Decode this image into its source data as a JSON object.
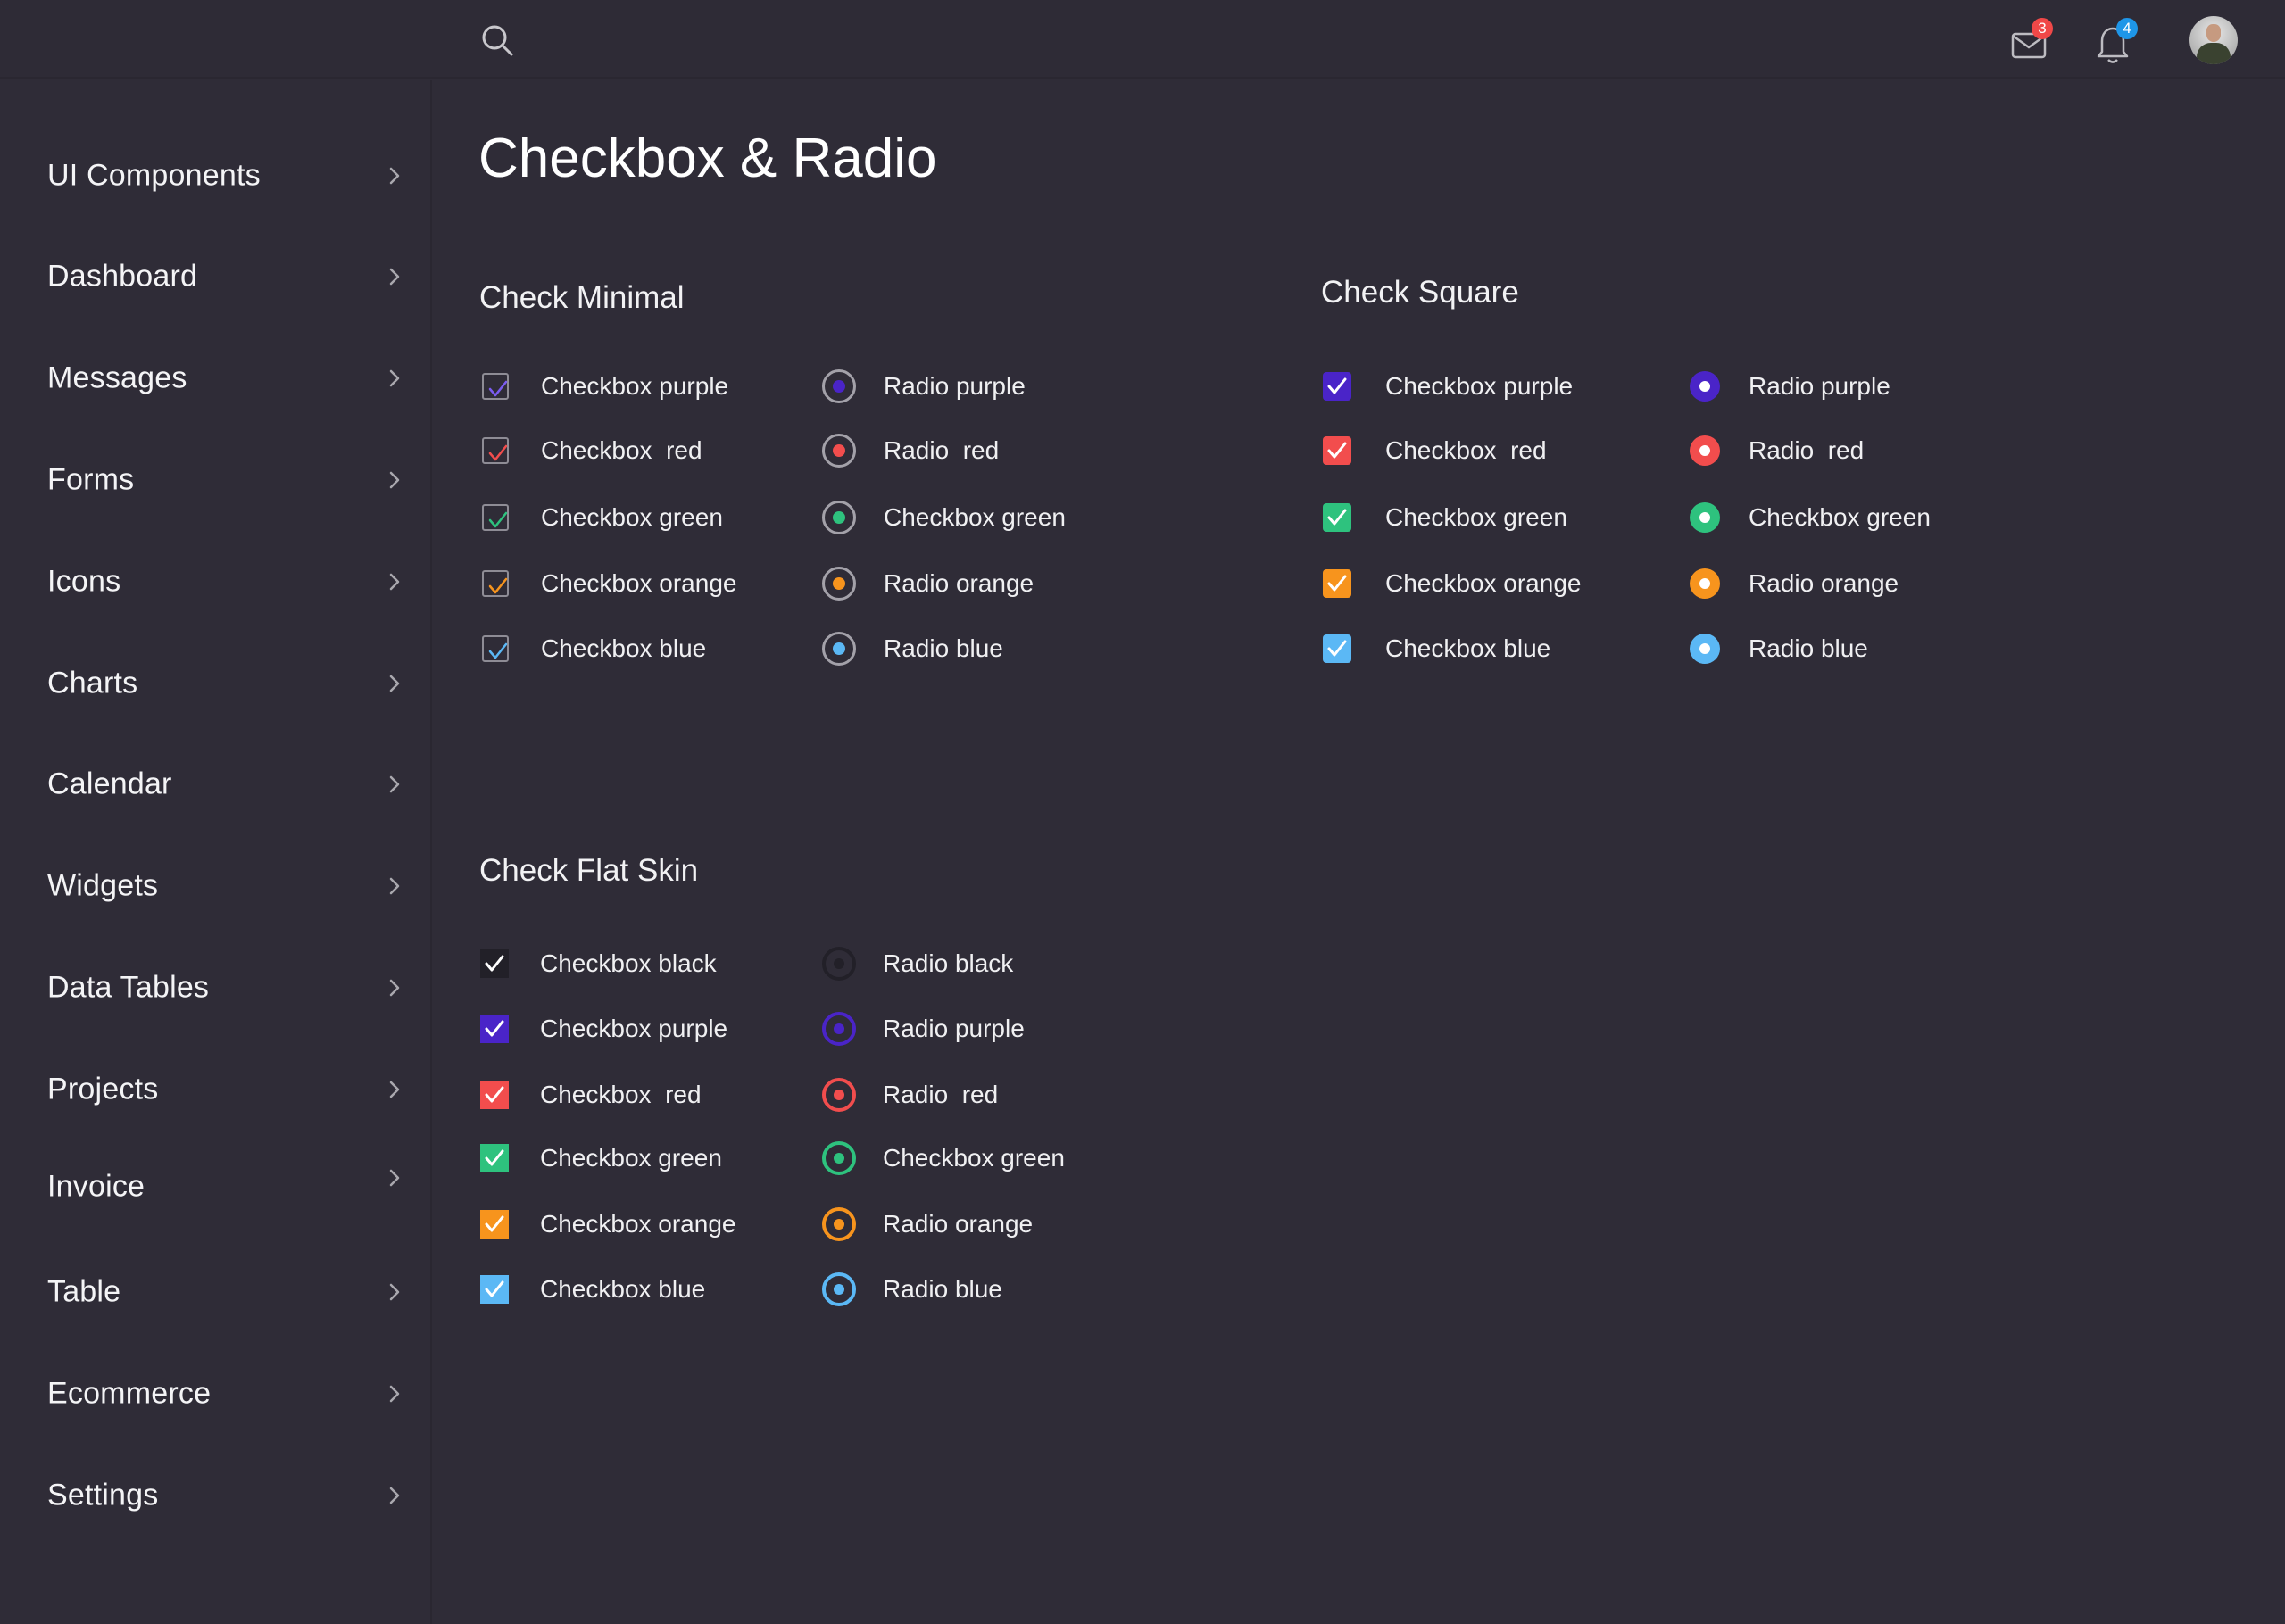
{
  "topbar": {
    "search_icon": "search-icon",
    "mail": {
      "icon": "mail-icon",
      "badge": "3",
      "badge_color": "#f04848"
    },
    "notifications": {
      "icon": "bell-icon",
      "badge": "4",
      "badge_color": "#1e96e8"
    },
    "avatar": "user-avatar"
  },
  "sidebar": {
    "items": [
      {
        "label": "UI Components"
      },
      {
        "label": "Dashboard"
      },
      {
        "label": "Messages"
      },
      {
        "label": "Forms"
      },
      {
        "label": "Icons"
      },
      {
        "label": "Charts"
      },
      {
        "label": "Calendar"
      },
      {
        "label": "Widgets"
      },
      {
        "label": "Data Tables"
      },
      {
        "label": "Projects"
      },
      {
        "label": "Invoice"
      },
      {
        "label": "Table"
      },
      {
        "label": "Ecommerce"
      },
      {
        "label": "Settings"
      }
    ]
  },
  "page": {
    "title": "Checkbox & Radio"
  },
  "colors": {
    "purple": "#4a24c8",
    "purple_minimal": "#7b5cf0",
    "red": "#f24d4d",
    "green": "#2ec27e",
    "orange": "#f7941d",
    "blue": "#5bb8f5",
    "black": "#222028"
  },
  "sections": {
    "minimal": {
      "title": "Check Minimal",
      "checkboxes": [
        {
          "label": "Checkbox purple",
          "color": "purple_minimal",
          "checked": true
        },
        {
          "label": "Checkbox  red",
          "color": "red",
          "checked": true
        },
        {
          "label": "Checkbox green",
          "color": "green",
          "checked": true
        },
        {
          "label": "Checkbox orange",
          "color": "orange",
          "checked": true
        },
        {
          "label": "Checkbox blue",
          "color": "blue",
          "checked": true
        }
      ],
      "radios": [
        {
          "label": "Radio purple",
          "color": "purple",
          "checked": true
        },
        {
          "label": "Radio  red",
          "color": "red",
          "checked": true
        },
        {
          "label": "Checkbox green",
          "color": "green",
          "checked": true
        },
        {
          "label": "Radio orange",
          "color": "orange",
          "checked": true
        },
        {
          "label": "Radio blue",
          "color": "blue",
          "checked": true
        }
      ]
    },
    "square": {
      "title": "Check Square",
      "checkboxes": [
        {
          "label": "Checkbox purple",
          "color": "purple",
          "checked": true
        },
        {
          "label": "Checkbox  red",
          "color": "red",
          "checked": true
        },
        {
          "label": "Checkbox green",
          "color": "green",
          "checked": true
        },
        {
          "label": "Checkbox orange",
          "color": "orange",
          "checked": true
        },
        {
          "label": "Checkbox blue",
          "color": "blue",
          "checked": true
        }
      ],
      "radios": [
        {
          "label": "Radio purple",
          "color": "purple",
          "checked": true
        },
        {
          "label": "Radio  red",
          "color": "red",
          "checked": true
        },
        {
          "label": "Checkbox green",
          "color": "green",
          "checked": true
        },
        {
          "label": "Radio orange",
          "color": "orange",
          "checked": true
        },
        {
          "label": "Radio blue",
          "color": "blue",
          "checked": true
        }
      ]
    },
    "flat": {
      "title": "Check Flat Skin",
      "checkboxes": [
        {
          "label": "Checkbox black",
          "color": "black",
          "checked": true
        },
        {
          "label": "Checkbox purple",
          "color": "purple",
          "checked": true
        },
        {
          "label": "Checkbox  red",
          "color": "red",
          "checked": true
        },
        {
          "label": "Checkbox green",
          "color": "green",
          "checked": true
        },
        {
          "label": "Checkbox orange",
          "color": "orange",
          "checked": true
        },
        {
          "label": "Checkbox blue",
          "color": "blue",
          "checked": true
        }
      ],
      "radios": [
        {
          "label": "Radio black",
          "color": "black",
          "checked": true
        },
        {
          "label": "Radio purple",
          "color": "purple",
          "checked": true
        },
        {
          "label": "Radio  red",
          "color": "red",
          "checked": true
        },
        {
          "label": "Checkbox green",
          "color": "green",
          "checked": true
        },
        {
          "label": "Radio orange",
          "color": "orange",
          "checked": true
        },
        {
          "label": "Radio blue",
          "color": "blue",
          "checked": true
        }
      ]
    }
  }
}
